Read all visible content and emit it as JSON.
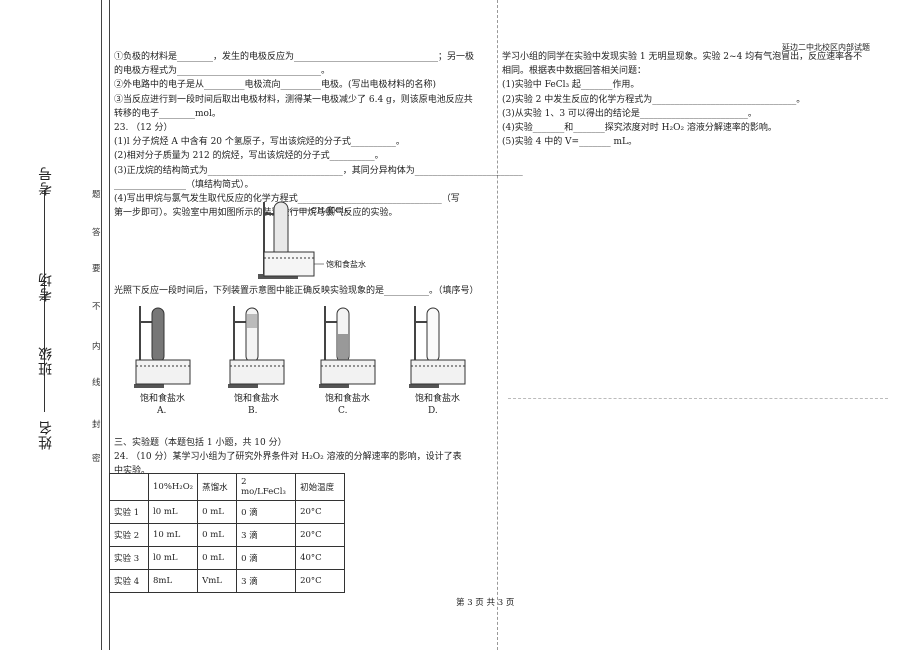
{
  "binding_margin": {
    "name_label": "姓名",
    "class_label": "班级",
    "room_label": "考场",
    "number_label": "考号",
    "seal_chars": [
      "密",
      "封",
      "线",
      "内",
      "不",
      "要",
      "答",
      "题"
    ]
  },
  "header_right": "延边二中北校区内部试题",
  "left_column": {
    "lines": [
      "①负极的材料是________，发生的电极反应为________________________________；另一极",
      "的电极方程式为________________________________。",
      "②外电路中的电子是从_________电极流向_________电极。(写出电极材料的名称)",
      "③当反应进行到一段时间后取出电极材料，测得某一电极减少了 6.4 g，则该原电池反应共",
      "转移的电子________mol。",
      "23. （12 分）",
      "(1)l 分子烷烃 A 中含有 20 个氢原子，写出该烷烃的分子式__________。",
      "(2)相对分子质量为 212 的烷烃，写出该烷烃的分子式__________。",
      "(3)正戊烷的结构简式为______________________________，其同分异构体为________________________",
      "________________（填结构简式）。",
      "(4)写出甲烷与氯气发生取代反应的化学方程式________________________________（写",
      "第一步即可）。实验室中用如图所示的装置进行甲烷与氯气反应的实验。"
    ],
    "apparatus_gas_label": "CH₄和Cl₂",
    "apparatus_liquid_label": "饱和食盐水",
    "question_line": "光照下反应一段时间后，下列装置示意图中能正确反映实验现象的是__________。（填序号）",
    "options": [
      {
        "letter": "A.",
        "caption": "饱和食盐水"
      },
      {
        "letter": "B.",
        "caption": "饱和食盐水"
      },
      {
        "letter": "C.",
        "caption": "饱和食盐水"
      },
      {
        "letter": "D.",
        "caption": "饱和食盐水"
      }
    ],
    "section_title": "三、实验题（本题包括 1 小题，共 10 分）",
    "q24_line1": "24. （10 分）某学习小组为了研究外界条件对 H₂O₂ 溶液的分解速率的影响，设计了表",
    "q24_line2": "中实验。"
  },
  "table": {
    "headers": [
      "",
      "10%H₂O₂",
      "蒸馏水",
      "2 mo/LFeCl₃",
      "初始温度"
    ],
    "rows": [
      [
        "实验 1",
        "l0 mL",
        "0 mL",
        "0 滴",
        "20°C"
      ],
      [
        "实验 2",
        "10 mL",
        "0 mL",
        "3 滴",
        "20°C"
      ],
      [
        "实验 3",
        "l0 mL",
        "0 mL",
        "0 滴",
        "40°C"
      ],
      [
        "实验 4",
        "8mL",
        "VmL",
        "3 滴",
        "20°C"
      ]
    ]
  },
  "right_column": {
    "lines": [
      "学习小组的同学在实验中发现实验 1 无明显现象。实验 2~4 均有气泡冒出，反应速率各不",
      "相同。根据表中数据回答相关问题：",
      "(1)实验中 FeCl₃ 起_______作用。",
      "(2)实验 2 中发生反应的化学方程式为________________________________。",
      "(3)从实验 1、3 可以得出的结论是________________________。",
      "(4)实验_______和_______探究浓度对时 H₂O₂ 溶液分解速率的影响。",
      "(5)实验 4 中的 V=_______ mL。"
    ]
  },
  "footer": "第 3 页 共 3 页"
}
